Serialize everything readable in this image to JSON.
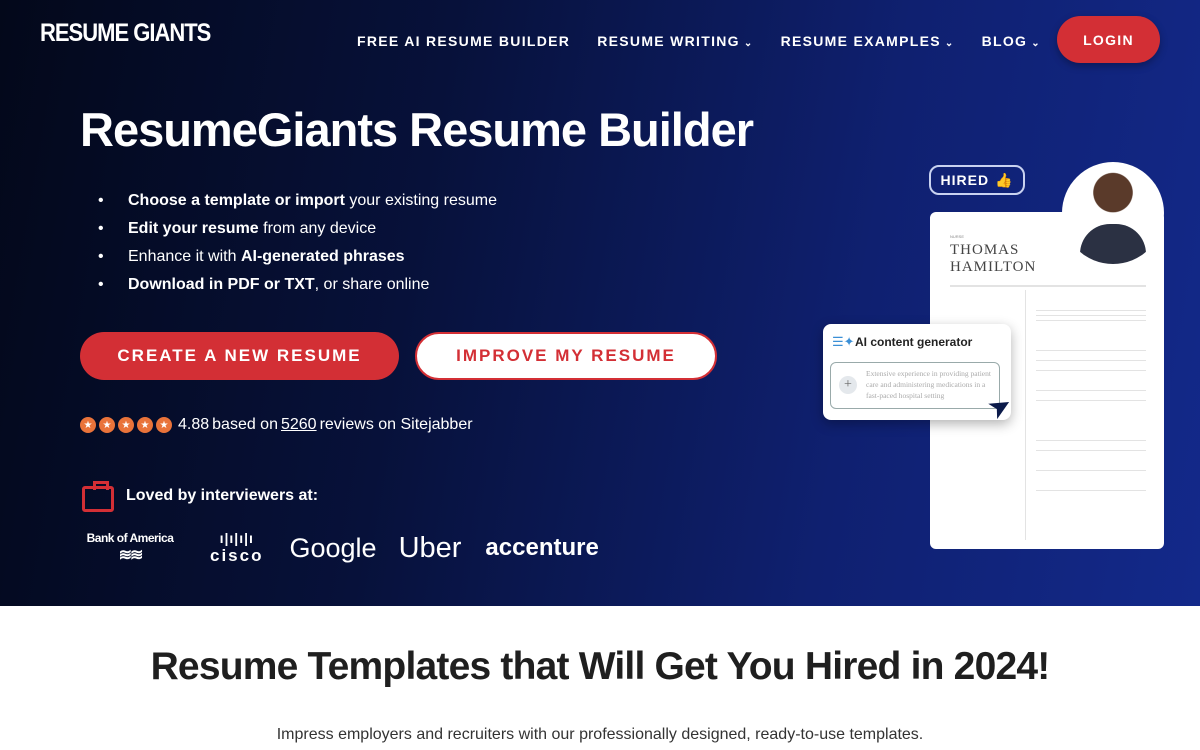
{
  "header": {
    "logo": "RESUME GIANTS",
    "nav": [
      {
        "label": "FREE AI RESUME BUILDER",
        "dropdown": false
      },
      {
        "label": "RESUME WRITING",
        "dropdown": true
      },
      {
        "label": "RESUME EXAMPLES",
        "dropdown": true
      },
      {
        "label": "BLOG",
        "dropdown": true
      }
    ],
    "login": "LOGIN"
  },
  "hero": {
    "title": "ResumeGiants Resume Builder",
    "bullets": [
      {
        "bold": "Choose a template or import",
        "rest": " your existing resume"
      },
      {
        "bold": "Edit your resume",
        "rest": " from any device"
      },
      {
        "pre": "Enhance it with ",
        "bold": "AI-generated phrases"
      },
      {
        "bold": "Download in PDF or TXT",
        "rest": ", or share online"
      }
    ],
    "cta_primary": "CREATE A NEW RESUME",
    "cta_secondary": "IMPROVE MY RESUME",
    "rating": {
      "stars": 5,
      "score": "4.88",
      "pre": "based on",
      "count": "5260",
      "post": "reviews on Sitejabber"
    },
    "loved_by": "Loved by interviewers at:",
    "companies": [
      "Bank of America",
      "cisco",
      "Google",
      "Uber",
      "accenture"
    ],
    "illustration": {
      "badge": "HIRED",
      "role": "NURSE",
      "name_line1": "THOMAS",
      "name_line2": "HAMILTON",
      "ai_title": "AI content generator",
      "ai_text": "Extensive experience in providing patient care and administering medications in a fast-paced hospital setting"
    }
  },
  "section": {
    "title": "Resume Templates that Will Get You Hired in 2024!",
    "subtitle": "Impress employers and recruiters with our professionally designed, ready-to-use templates."
  },
  "colors": {
    "accent": "#d32f35",
    "hero_dark": "#03081a",
    "hero_blue": "#13298a",
    "star": "#e9733a"
  }
}
